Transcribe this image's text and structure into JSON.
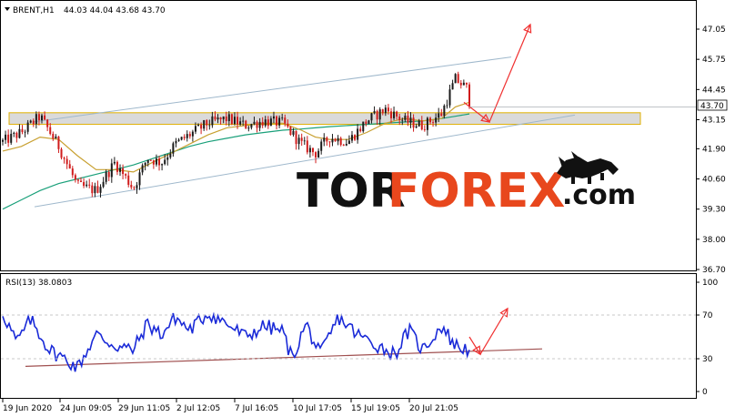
{
  "header": {
    "symbol": "BRENT,H1",
    "ohlc": "44.03 44.04 43.68 43.70"
  },
  "current_price_tag": "43.70",
  "watermark": {
    "part1": "TOR",
    "part2": "FOREX",
    "part3": ".com",
    "color_dark": "#111111",
    "color_accent": "#e8471d"
  },
  "colors": {
    "candle_up": "#1a1a1a",
    "candle_down": "#d01c1c",
    "ma_fast": "#c8a030",
    "ma_slow": "#1aa07a",
    "channel": "#9fb8cc",
    "zone_fill": "#d4d4d4",
    "zone_border": "#e0b000",
    "rsi_line": "#1a2ad8",
    "rsi_trend": "#a05050",
    "arrow": "#f03030",
    "grid": "#c8c8c8"
  },
  "chart_data": [
    {
      "type": "candlestick",
      "title": "BRENT,H1",
      "yticks": [
        "47.05",
        "45.75",
        "44.45",
        "43.15",
        "41.90",
        "40.60",
        "39.30",
        "38.00",
        "36.70"
      ],
      "xticks": [
        "19 Jun 2020",
        "24 Jun 09:05",
        "29 Jun 11:05",
        "2 Jul 12:05",
        "7 Jul 16:05",
        "10 Jul 17:05",
        "15 Jul 19:05",
        "20 Jul 21:05"
      ],
      "ylim": [
        36.7,
        47.05
      ],
      "path_t": [
        0,
        4,
        8,
        12,
        16,
        20,
        24,
        28,
        31,
        34,
        37,
        40,
        44,
        48,
        52,
        56,
        60,
        64,
        67,
        70,
        74,
        78,
        82,
        86,
        90,
        94,
        97,
        100
      ],
      "path_close": [
        42.2,
        42.6,
        43.3,
        42.0,
        40.3,
        40.1,
        41.3,
        40.2,
        41.5,
        41.3,
        42.1,
        42.5,
        43.0,
        43.2,
        42.9,
        43.1,
        43.0,
        42.1,
        41.7,
        42.4,
        42.2,
        43.1,
        43.6,
        43.1,
        42.9,
        43.4,
        44.9,
        44.4
      ],
      "last_close": 43.7,
      "ma_fast_path": [
        41.8,
        42.0,
        42.4,
        42.3,
        41.6,
        41.0,
        41.0,
        40.9,
        41.2,
        41.5,
        41.8,
        42.1,
        42.5,
        42.8,
        42.9,
        43.0,
        43.0,
        42.7,
        42.4,
        42.3,
        42.3,
        42.6,
        43.0,
        43.2,
        43.1,
        43.2,
        43.7,
        43.9
      ],
      "ma_slow_path": [
        39.3,
        39.7,
        40.1,
        40.4,
        40.6,
        40.8,
        41.0,
        41.2,
        41.4,
        41.6,
        41.8,
        42.0,
        42.2,
        42.35,
        42.5,
        42.6,
        42.7,
        42.75,
        42.8,
        42.85,
        42.9,
        42.95,
        43.0,
        43.05,
        43.1,
        43.2,
        43.3,
        43.4
      ],
      "support_zone": [
        42.95,
        43.45
      ],
      "channel_upper": {
        "from": [
          36,
          43.05
        ],
        "to": [
          562,
          45.85
        ]
      },
      "channel_lower": {
        "from": [
          38,
          39.4
        ],
        "to": [
          632,
          43.35
        ]
      },
      "forecast_arrows": [
        {
          "from": [
            510,
            43.9
          ],
          "to": [
            538,
            43.05
          ]
        },
        {
          "from": [
            538,
            43.05
          ],
          "to": [
            583,
            47.25
          ]
        }
      ]
    },
    {
      "type": "line",
      "title": "RSI(13) 38.0803",
      "yticks": [
        "100",
        "70",
        "30",
        "0"
      ],
      "ylim": [
        0,
        100
      ],
      "path_t": [
        0,
        3,
        6,
        10,
        14,
        16,
        20,
        24,
        28,
        31,
        34,
        37,
        40,
        44,
        48,
        52,
        56,
        60,
        62,
        65,
        68,
        72,
        76,
        80,
        84,
        87,
        90,
        94,
        97,
        100
      ],
      "path_value": [
        72,
        45,
        66,
        38,
        28,
        22,
        52,
        42,
        38,
        62,
        52,
        68,
        56,
        72,
        62,
        50,
        60,
        55,
        30,
        62,
        33,
        68,
        52,
        43,
        34,
        56,
        38,
        60,
        42,
        38
      ],
      "last_value": 38.0803,
      "trendline": {
        "from": [
          28,
          23
        ],
        "to": [
          596,
          39
        ]
      },
      "forecast_arrows": [
        {
          "from": [
            516,
            50
          ],
          "to": [
            528,
            34
          ]
        },
        {
          "from": [
            528,
            34
          ],
          "to": [
            558,
            76
          ]
        }
      ]
    }
  ]
}
